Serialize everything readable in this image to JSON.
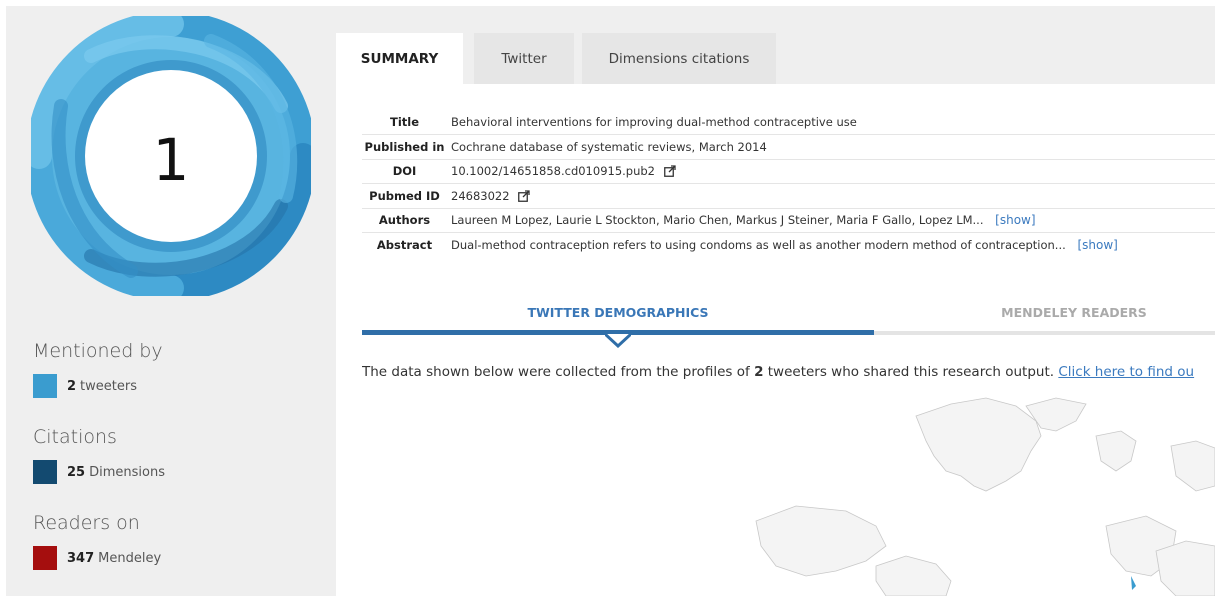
{
  "sidebar": {
    "score": "1",
    "sections": [
      {
        "heading": "Mentioned by",
        "count": "2",
        "label": "tweeters",
        "color": "#3a9ccf"
      },
      {
        "heading": "Citations",
        "count": "25",
        "label": "Dimensions",
        "color": "#134a70"
      },
      {
        "heading": "Readers on",
        "count": "347",
        "label": "Mendeley",
        "color": "#a50e0e"
      }
    ]
  },
  "tabs": [
    "SUMMARY",
    "Twitter",
    "Dimensions citations"
  ],
  "meta": {
    "title_label": "Title",
    "title_value": "Behavioral interventions for improving dual-method contraceptive use",
    "published_label": "Published in",
    "published_value": "Cochrane database of systematic reviews, March 2014",
    "doi_label": "DOI",
    "doi_value": "10.1002/14651858.cd010915.pub2",
    "pubmed_label": "Pubmed ID",
    "pubmed_value": "24683022",
    "authors_label": "Authors",
    "authors_value": "Laureen M Lopez, Laurie L Stockton, Mario Chen, Markus J Steiner, Maria F Gallo, Lopez LM...",
    "abstract_label": "Abstract",
    "abstract_value": "Dual-method contraception refers to using condoms as well as another modern method of contraception...",
    "show_label": "[show]"
  },
  "subtabs": [
    "TWITTER DEMOGRAPHICS",
    "MENDELEY READERS"
  ],
  "description": {
    "before": "The data shown below were collected from the profiles of ",
    "count": "2",
    "after": " tweeters who shared this research output. ",
    "link": "Click here to find ou"
  },
  "icons": {
    "external": "external-link-icon",
    "caret": "caret-down-icon"
  }
}
